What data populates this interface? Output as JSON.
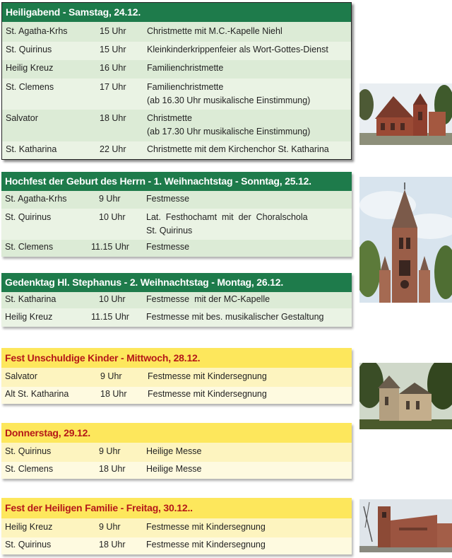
{
  "sections": [
    {
      "title": "Heiligabend - Samstag, 24.12.",
      "rows": [
        {
          "place": "St. Agatha-Krhs",
          "time": "15 Uhr",
          "event": "Christmette mit M.C.-Kapelle Niehl"
        },
        {
          "place": "St. Quirinus",
          "time": "15 Uhr",
          "event": "Kleinkinderkrippenfeier als Wort-Gottes-Dienst"
        },
        {
          "place": "Heilig Kreuz",
          "time": "16 Uhr",
          "event": "Familienchristmette"
        },
        {
          "place": "St. Clemens",
          "time": "17 Uhr",
          "event": "Familienchristmette",
          "event2": "(ab 16.30 Uhr musikalische Einstimmung)"
        },
        {
          "place": "Salvator",
          "time": "18 Uhr",
          "event": "Christmette",
          "event2": "(ab 17.30 Uhr musikalische Einstimmung)"
        },
        {
          "place": "St. Katharina",
          "time": "22 Uhr",
          "event": "Christmette mit dem Kirchenchor St. Katharina"
        }
      ]
    },
    {
      "title": "Hochfest der Geburt des Herrn - 1. Weihnachtstag - Sonntag, 25.12.",
      "rows": [
        {
          "place": "St. Agatha-Krhs",
          "time": "9 Uhr",
          "event": "Festmesse"
        },
        {
          "place": "St. Quirinus",
          "time": "10 Uhr",
          "event": "Lat.  Festhochamt  mit  der  Choralschola",
          "event2": "St. Quirinus"
        },
        {
          "place": "St. Clemens",
          "time": "11.15 Uhr",
          "event": "Festmesse"
        }
      ]
    },
    {
      "title": "Gedenktag Hl. Stephanus - 2. Weihnachtstag - Montag, 26.12.",
      "rows": [
        {
          "place": "St. Katharina",
          "time": "10 Uhr",
          "event": "Festmesse  mit der MC-Kapelle"
        },
        {
          "place": "Heilig Kreuz",
          "time": "11.15 Uhr",
          "event": "Festmesse mit bes. musikalischer Gestaltung"
        }
      ]
    },
    {
      "title": "Fest Unschuldige Kinder - Mittwoch, 28.12.",
      "rows": [
        {
          "place": "Salvator",
          "time": "9 Uhr",
          "event": "Festmesse mit Kindersegnung"
        },
        {
          "place": "Alt St. Katharina",
          "time": "18 Uhr",
          "event": "Festmesse mit Kindersegnung"
        }
      ]
    },
    {
      "title": "Donnerstag, 29.12.",
      "rows": [
        {
          "place": "St. Quirinus",
          "time": "9 Uhr",
          "event": "Heilige Messe"
        },
        {
          "place": "St. Clemens",
          "time": "18 Uhr",
          "event": "Heilige Messe"
        }
      ]
    },
    {
      "title": "Fest der Heiligen Familie - Freitag, 30.12..",
      "rows": [
        {
          "place": "Heilig Kreuz",
          "time": "9 Uhr",
          "event": "Festmesse mit Kindersegnung"
        },
        {
          "place": "St. Quirinus",
          "time": "18 Uhr",
          "event": "Festmesse mit Kindersegnung"
        }
      ]
    }
  ],
  "colors": {
    "green_header": "#1e7b4b",
    "yellow_header": "#fde75c",
    "yellow_header_text": "#b51818"
  }
}
